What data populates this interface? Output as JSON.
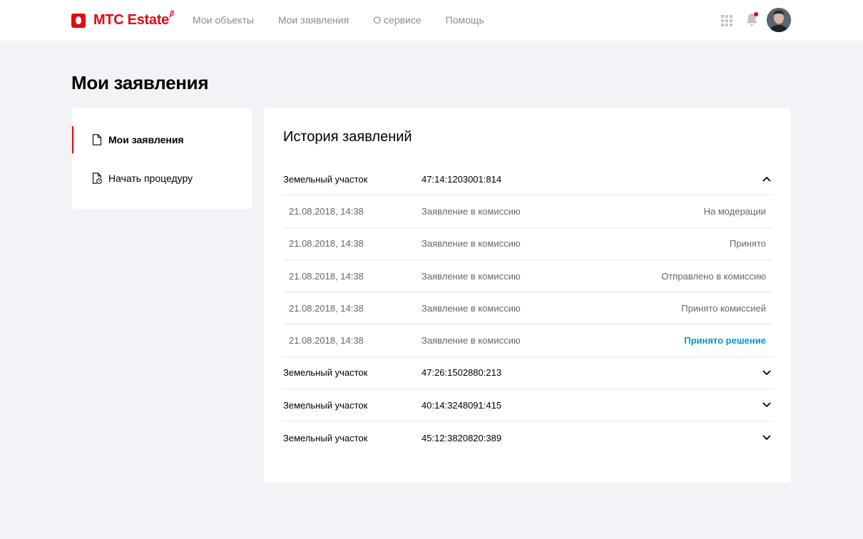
{
  "header": {
    "logo_text": "МТС Estate",
    "logo_beta": "β",
    "nav": [
      "Мои объекты",
      "Мои заявления",
      "О сервисе",
      "Помощь"
    ]
  },
  "page_title": "Мои заявления",
  "sidebar": {
    "items": [
      {
        "label": "Мои заявления",
        "icon": "document-icon",
        "active": true
      },
      {
        "label": "Начать процедуру",
        "icon": "document-clock-icon",
        "active": false
      }
    ]
  },
  "history": {
    "title": "История заявлений",
    "groups": [
      {
        "type": "Земельный участок",
        "number": "47:14:1203001:814",
        "expanded": true,
        "entries": [
          {
            "date": "21.08.2018, 14:38",
            "kind": "Заявление в комиссию",
            "status": "На модерации"
          },
          {
            "date": "21.08.2018, 14:38",
            "kind": "Заявление в комиссию",
            "status": "Принято"
          },
          {
            "date": "21.08.2018, 14:38",
            "kind": "Заявление в комиссию",
            "status": "Отправлено в комиссию"
          },
          {
            "date": "21.08.2018, 14:38",
            "kind": "Заявление в комиссию",
            "status": "Принято комиссией"
          },
          {
            "date": "21.08.2018, 14:38",
            "kind": "Заявление в комиссию",
            "status": "Принято решение"
          }
        ]
      },
      {
        "type": "Земельный участок",
        "number": "47:26:1502880:213",
        "expanded": false
      },
      {
        "type": "Земельный участок",
        "number": "40:14:3248091:415",
        "expanded": false
      },
      {
        "type": "Земельный участок",
        "number": "45:12:3820820:389",
        "expanded": false
      }
    ]
  },
  "colors": {
    "brand": "#e30611",
    "link": "#0097d0",
    "background": "#f2f3f7"
  }
}
